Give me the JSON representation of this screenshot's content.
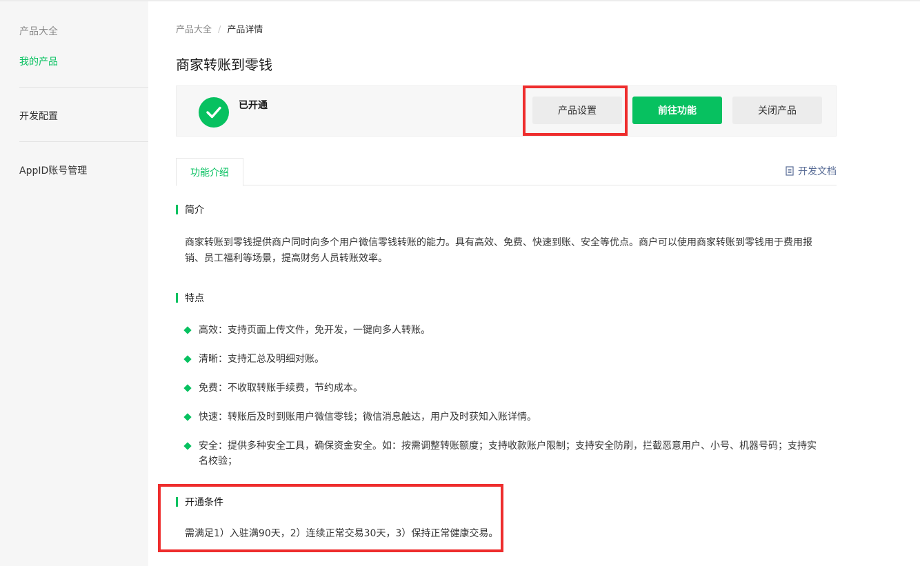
{
  "sidebar": {
    "items": [
      {
        "label": "产品大全"
      },
      {
        "label": "我的产品"
      },
      {
        "label": "开发配置"
      },
      {
        "label": "AppID账号管理"
      }
    ]
  },
  "breadcrumb": {
    "root": "产品大全",
    "separator": "/",
    "current": "产品详情"
  },
  "page_title": "商家转账到零钱",
  "status": {
    "icon": "check-circle-icon",
    "text": "已开通",
    "buttons": {
      "settings": "产品设置",
      "goto": "前往功能",
      "close": "关闭产品"
    }
  },
  "tabs": {
    "active": "功能介绍",
    "dev_doc": "开发文档",
    "dev_doc_icon": "document-icon"
  },
  "intro": {
    "heading": "简介",
    "text": "商家转账到零钱提供商户同时向多个用户微信零钱转账的能力。具有高效、免费、快速到账、安全等优点。商户可以使用商家转账到零钱用于费用报销、员工福利等场景，提高财务人员转账效率。"
  },
  "features": {
    "heading": "特点",
    "items": [
      {
        "text": "高效：支持页面上传文件，免开发，一键向多人转账。"
      },
      {
        "text": "清晰：支持汇总及明细对账。"
      },
      {
        "text": "免费：不收取转账手续费，节约成本。"
      },
      {
        "text": "快速：转账后及时到账用户微信零钱；微信消息触达，用户及时获知入账详情。"
      },
      {
        "text": "安全：提供多种安全工具，确保资金安全。如：按需调整转账额度；支持收款账户限制；支持安全防刷，拦截恶意用户、小号、机器号码；支持实名校验；"
      }
    ]
  },
  "conditions": {
    "heading": "开通条件",
    "text": "需满足1）入驻满90天，2）连续正常交易30天，3）保持正常健康交易。"
  },
  "colors": {
    "accent": "#07c160",
    "highlight": "#ee2d2d",
    "link": "#576b95"
  }
}
